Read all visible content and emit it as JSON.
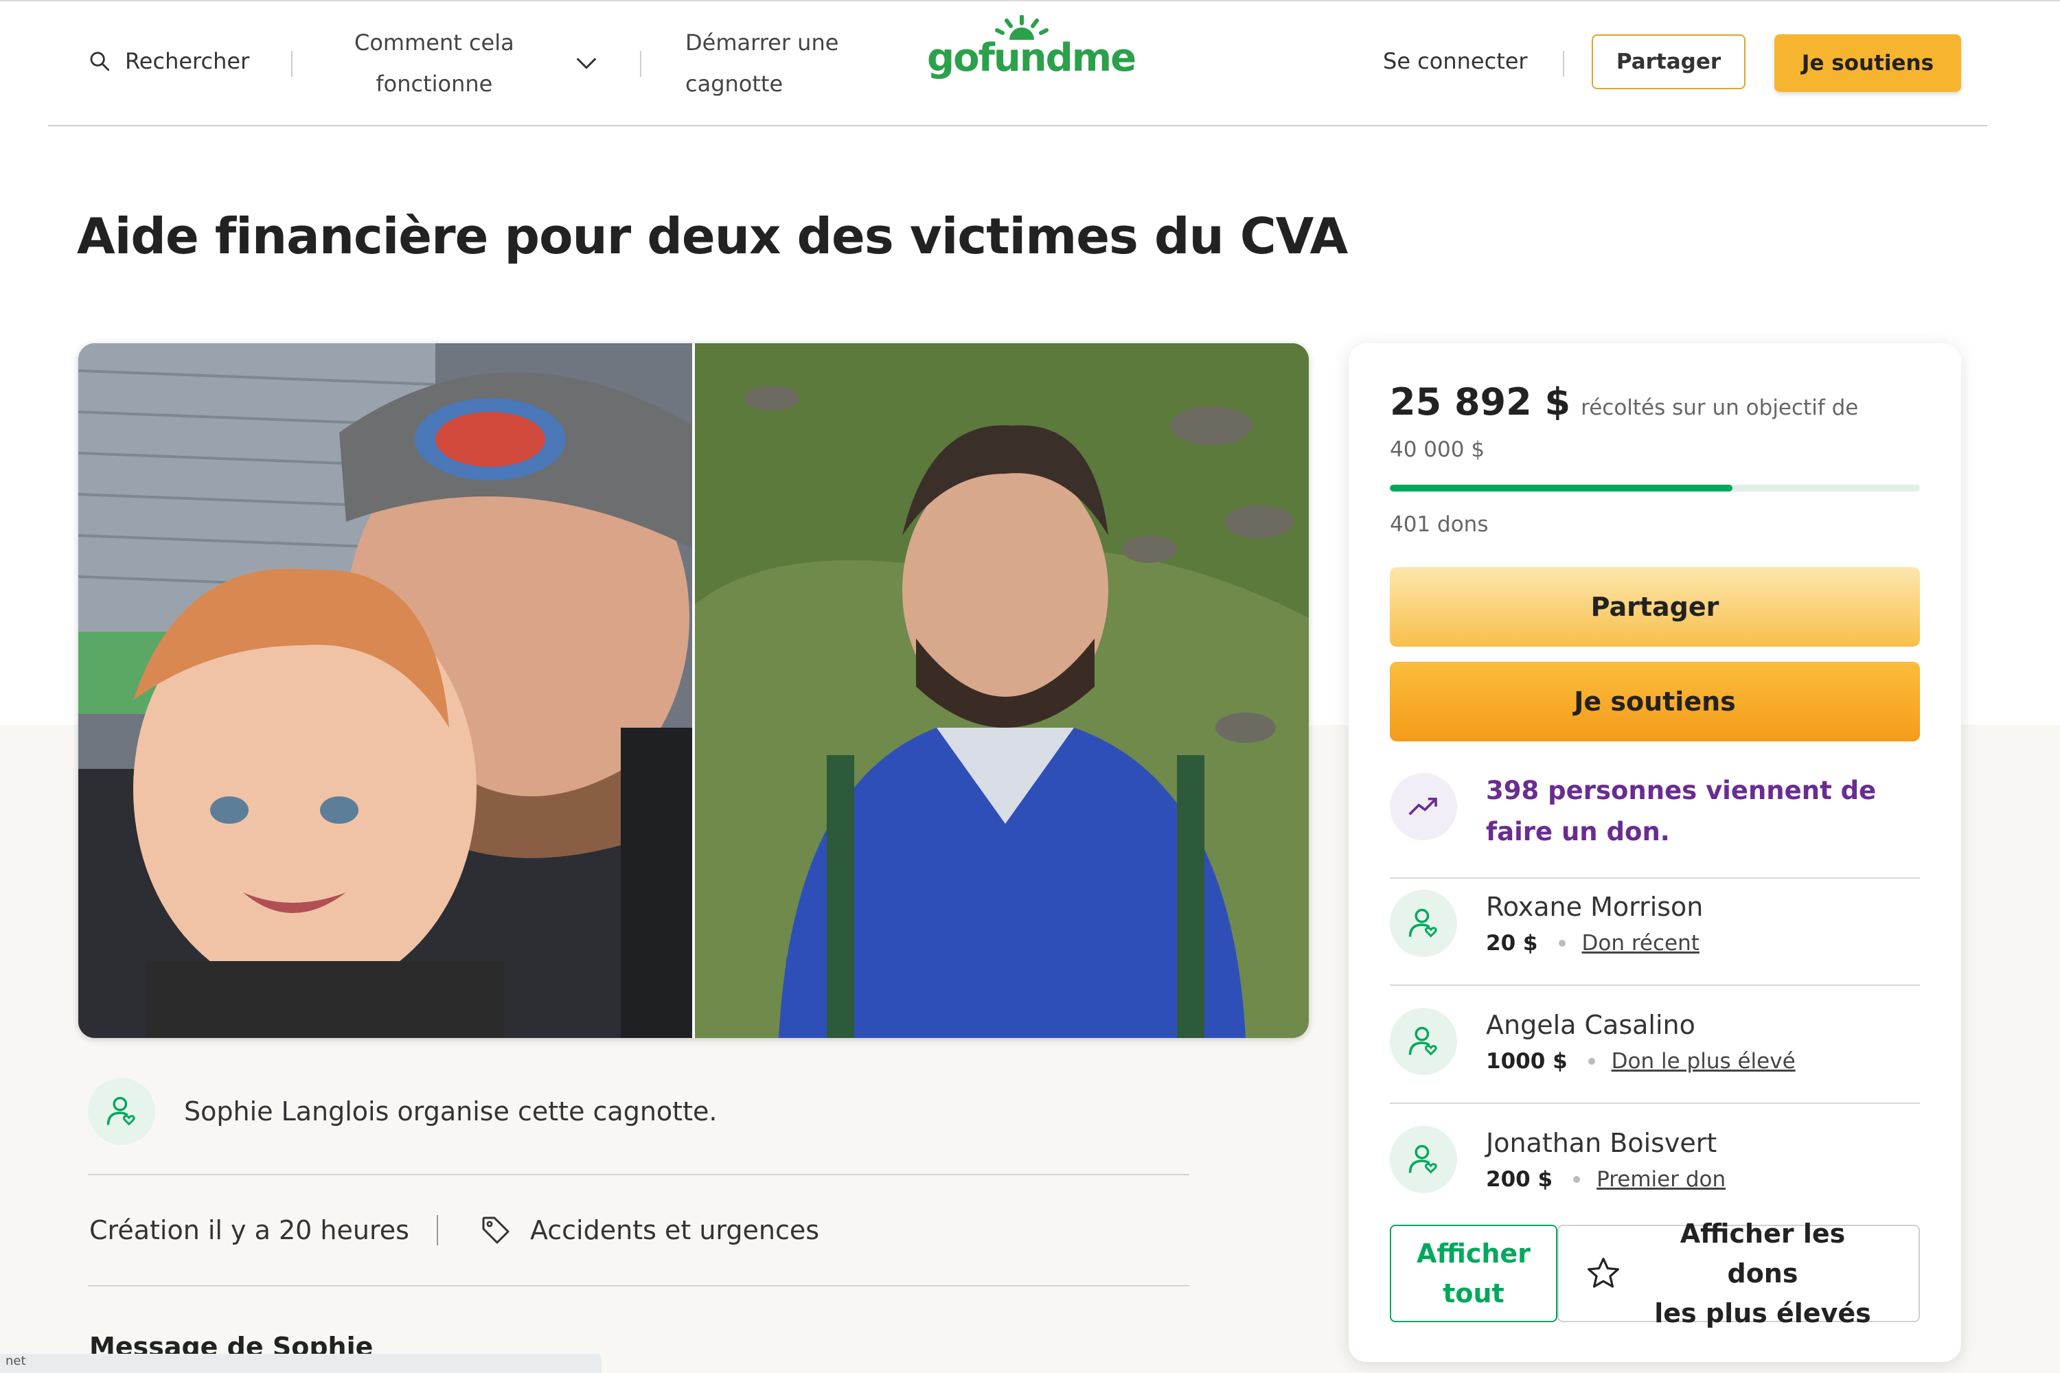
{
  "header": {
    "search_label": "Rechercher",
    "how_it_works": [
      "Comment cela",
      "fonctionne"
    ],
    "start_fundraiser": [
      "Démarrer une",
      "cagnotte"
    ],
    "logo_text": "gofundme",
    "signin_label": "Se connecter",
    "share_label": "Partager",
    "donate_label": "Je soutiens"
  },
  "campaign": {
    "title": "Aide financière pour deux des victimes du CVA",
    "organizer_text": "Sophie Langlois organise cette cagnotte.",
    "created_text": "Création il y a 20 heures",
    "category": "Accidents et urgences",
    "message_heading": "Message de Sophie"
  },
  "panel": {
    "amount_raised": "25 892 $",
    "goal_text": "récoltés sur un objectif de",
    "goal_amount": "40 000 $",
    "progress_fraction": 0.647,
    "donations_count": "401 dons",
    "share_button": "Partager",
    "donate_button": "Je soutiens",
    "trending_text": "398 personnes viennent de faire un don.",
    "donors": [
      {
        "name": "Roxane Morrison",
        "amount": "20 $",
        "tag": "Don récent"
      },
      {
        "name": "Angela Casalino",
        "amount": "1000 $",
        "tag": "Don le plus élevé"
      },
      {
        "name": "Jonathan Boisvert",
        "amount": "200 $",
        "tag": "Premier don"
      }
    ],
    "see_all_label": [
      "Afficher",
      "tout"
    ],
    "see_top_label": [
      "Afficher les dons",
      "les plus élevés"
    ]
  },
  "statusbar_text": "net",
  "colors": {
    "brand_green": "#02a95c",
    "accent_yellow": "#f7b52f",
    "trend_purple": "#6a2c91"
  }
}
